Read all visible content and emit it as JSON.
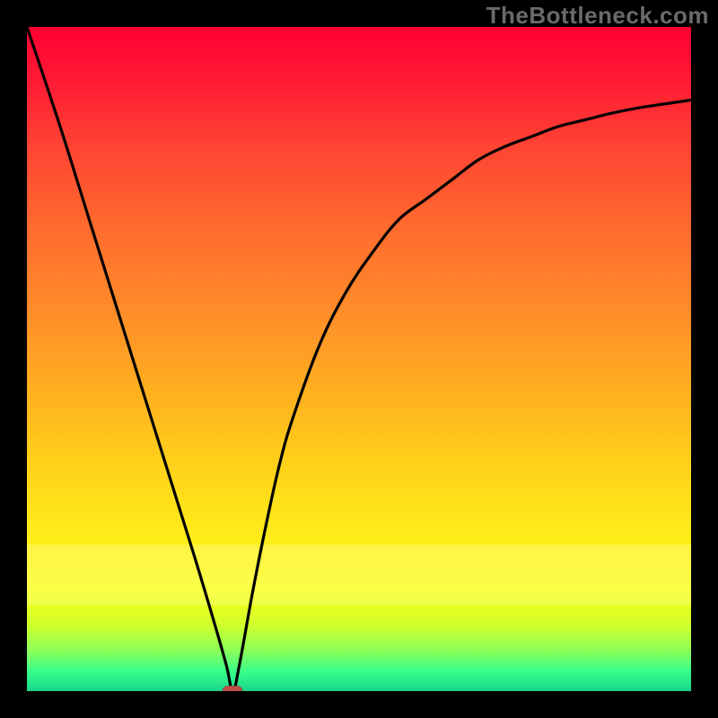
{
  "watermark": "TheBottleneck.com",
  "chart_data": {
    "type": "line",
    "title": "",
    "xlabel": "",
    "ylabel": "",
    "xlim": [
      0,
      100
    ],
    "ylim": [
      0,
      100
    ],
    "grid": false,
    "legend": null,
    "background_gradient": {
      "top": "#ff0033",
      "mid": "#ffd21a",
      "bottom": "#17d58c"
    },
    "series": [
      {
        "name": "curve",
        "color": "#000000",
        "x": [
          0,
          5,
          10,
          15,
          20,
          25,
          28,
          30,
          31,
          32,
          34,
          36,
          38,
          40,
          44,
          48,
          52,
          56,
          60,
          64,
          68,
          72,
          76,
          80,
          84,
          88,
          92,
          96,
          100
        ],
        "values": [
          100,
          85,
          69,
          53,
          37,
          21,
          11,
          4,
          0,
          4,
          15,
          25,
          34,
          41,
          52,
          60,
          66,
          71,
          74,
          77,
          80,
          82,
          83.5,
          85,
          86,
          87,
          87.8,
          88.4,
          89
        ]
      }
    ],
    "marker": {
      "x": 31,
      "y": 0,
      "color": "#bf4e48"
    }
  }
}
